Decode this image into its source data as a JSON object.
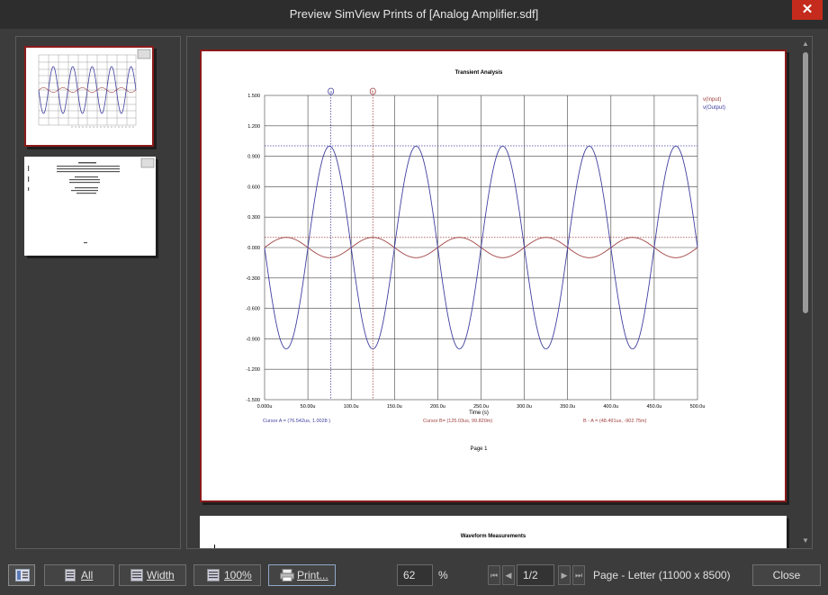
{
  "window": {
    "title": "Preview SimView Prints of [Analog Amplifier.sdf]",
    "close_symbol": "✕"
  },
  "page1": {
    "chart_title": "Transient Analysis",
    "legend": [
      {
        "label": "v(Input)",
        "color": "#a04040"
      },
      {
        "label": "v(Output)",
        "color": "#4040a0"
      }
    ],
    "y_ticks": [
      "1.500",
      "1.200",
      "0.900",
      "0.600",
      "0.300",
      "0.000",
      "-0.300",
      "-0.600",
      "-0.900",
      "-1.200",
      "-1.500"
    ],
    "x_ticks": [
      "0.000u",
      "50.00u",
      "100.0u",
      "150.0u",
      "200.0u",
      "250.0u",
      "300.0u",
      "350.0u",
      "400.0u",
      "450.0u",
      "500.0u"
    ],
    "x_label": "Time (s)",
    "cursor_a_text": "Cursor A = (76.542us, 1.0028 )",
    "cursor_b_text": "Cursor B= (125.03us, 99.820m)",
    "delta_text": "B - A = (48.491us, -902.75m)",
    "cursor_a_label": "a",
    "cursor_b_label": "b",
    "page_label": "Page 1"
  },
  "page2": {
    "title": "Waveform Measurements"
  },
  "chart_data": {
    "type": "line",
    "title": "Transient Analysis",
    "xlabel": "Time (s)",
    "ylabel": "",
    "xlim": [
      0,
      500
    ],
    "ylim": [
      -1.5,
      1.5
    ],
    "x_unit": "us",
    "grid": true,
    "legend_position": "top-right",
    "series": [
      {
        "name": "v(Input)",
        "color": "#a04040",
        "waveform": "sine",
        "amplitude": 0.1,
        "period_us": 100,
        "phase": "starts at 0 rising"
      },
      {
        "name": "v(Output)",
        "color": "#4040a0",
        "waveform": "sine",
        "amplitude": 1.0,
        "period_us": 100,
        "phase": "starts at 0 falling"
      }
    ],
    "cursors": [
      {
        "name": "A",
        "x": 76.542,
        "y": 1.0028,
        "color": "#4040a0"
      },
      {
        "name": "B",
        "x": 125.03,
        "y": 0.09982,
        "color": "#a04040"
      }
    ]
  },
  "toolbar": {
    "all_label": "All",
    "width_label": "Width",
    "zoom100_label": "100%",
    "print_label": "Print...",
    "zoom_value": "62",
    "zoom_unit": "%",
    "page_value": "1/2",
    "page_info": "Page - Letter (11000 x 8500)",
    "close_label": "Close"
  },
  "colors": {
    "input": "#a04040",
    "output": "#4040a0",
    "page_border": "#8b1a1a",
    "close_red": "#c42b1c"
  }
}
